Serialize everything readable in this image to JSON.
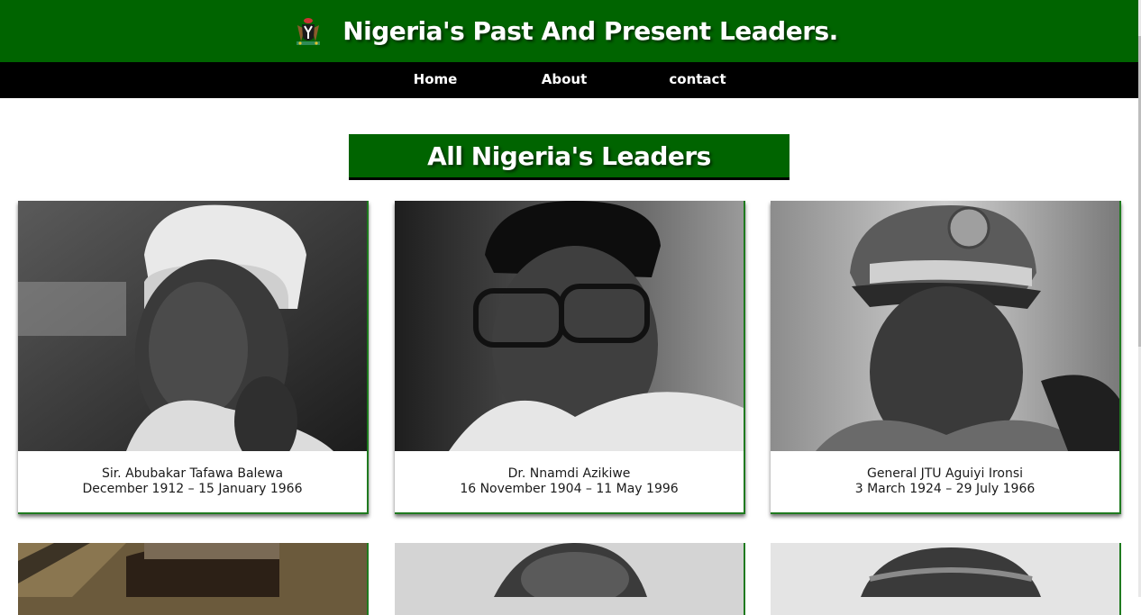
{
  "header": {
    "title": "Nigeria's Past And Present Leaders.",
    "logo_icon": "coat-of-arms-icon",
    "bg_color": "#006400"
  },
  "nav": {
    "items": [
      {
        "label": "Home"
      },
      {
        "label": "About"
      },
      {
        "label": "contact"
      }
    ],
    "bg_color": "#000000"
  },
  "section": {
    "title": "All Nigeria's Leaders"
  },
  "leaders": [
    {
      "name": "Sir. Abubakar Tafawa Balewa",
      "dates": "December 1912 – 15 January 1966"
    },
    {
      "name": "Dr. Nnamdi Azikiwe",
      "dates": "16 November 1904 – 11 May 1996"
    },
    {
      "name": "General JTU Aguiyi Ironsi",
      "dates": "3 March 1924 – 29 July 1966"
    }
  ],
  "accent_color": "#006400"
}
